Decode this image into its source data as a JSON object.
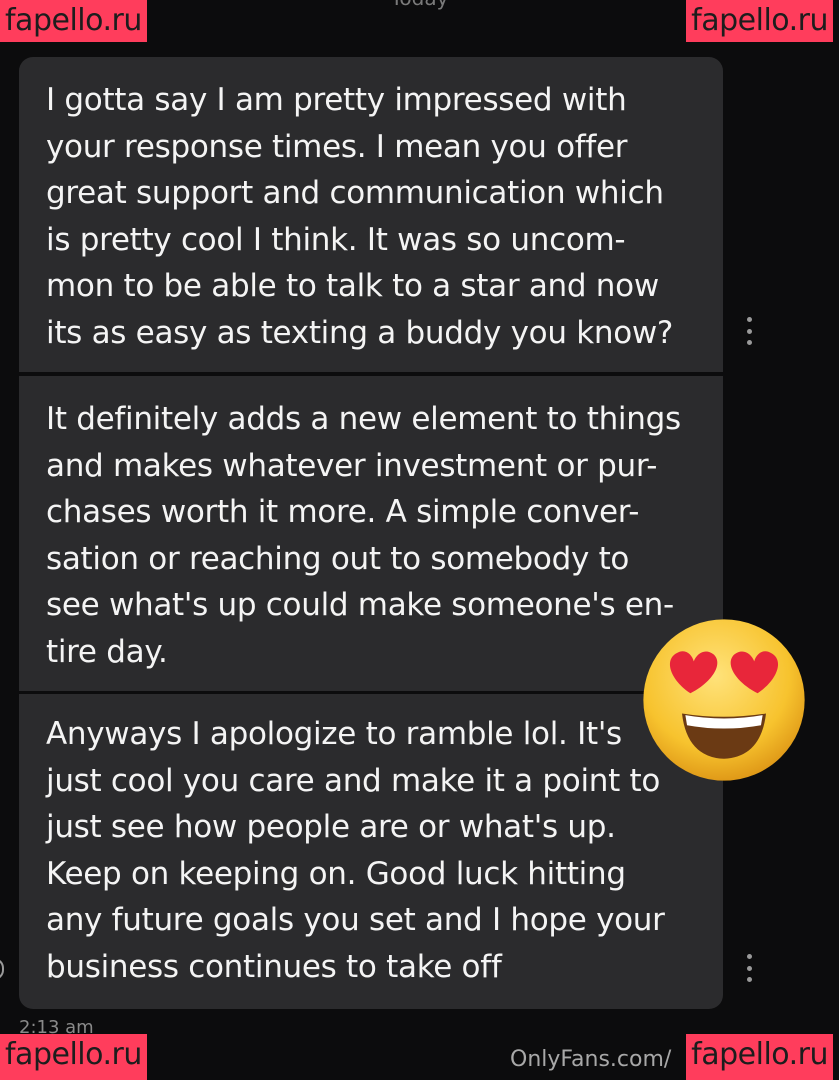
{
  "header": {
    "date_label": "Today"
  },
  "messages": [
    {
      "text": "I gotta say I am pretty impressed with your response times. I mean you offer great support and communication which is pretty cool I think. It was so uncom-mon to be able to talk to a star and now its as easy as texting a buddy you know?"
    },
    {
      "text": "It definitely adds a new element to things and makes whatever investment or pur-chases worth it more. A simple conver-sation or reaching out to somebody to see what's up could make someone's en-tire day."
    },
    {
      "text": "Anyways I apologize to ramble lol. It's just cool you care and make it a point to just see how people are or what's up. Keep on keeping on. Good luck hitting any future goals you set and I hope your business continues to take off"
    }
  ],
  "message_lines": [
    [
      "I gotta say I am pretty impressed with",
      "your response times. I mean you offer",
      "great support and communication which",
      "is pretty cool I think. It was so uncom-",
      "mon to be able to talk to a star and now",
      "its as easy as texting a buddy you know?"
    ],
    [
      "It definitely adds a new element to things",
      "and makes whatever investment or pur-",
      "chases worth it more. A simple conver-",
      "sation or reaching out to somebody to",
      "see what's up could make someone's en-",
      "tire day."
    ],
    [
      "Anyways I apologize to ramble lol. It's",
      "just cool you care and make it a point to",
      "just see how people are or what's up.",
      "Keep on keeping on. Good luck hitting",
      "any future goals you set and I hope your",
      "business continues to take off"
    ]
  ],
  "timestamp": "2:13 am",
  "footer": {
    "site": "OnlyFans.com/"
  },
  "watermarks": [
    "fapello.ru",
    "fapello.ru",
    "fapello.ru",
    "fapello.ru"
  ],
  "emoji": {
    "name": "heart-eyes-emoji",
    "face_color": "#f7c32e",
    "heart_color": "#e8263a"
  },
  "colors": {
    "background": "#0c0c0d",
    "bubble": "#2b2b2d",
    "watermark": "#ff3d5c"
  }
}
